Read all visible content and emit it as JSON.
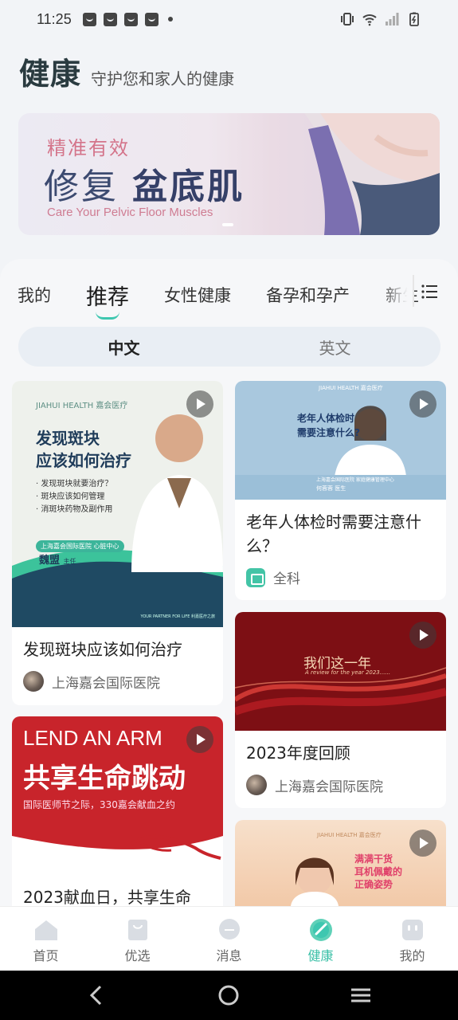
{
  "status_bar": {
    "time": "11:25",
    "notification_icons": [
      "notification-icon",
      "notification-icon",
      "notification-icon",
      "notification-icon"
    ],
    "right_icons": [
      "vibrate-icon",
      "wifi-icon",
      "signal-icon",
      "battery-charging-icon"
    ]
  },
  "header": {
    "title": "健康",
    "subtitle": "守护您和家人的健康"
  },
  "banner": {
    "tag": "精准有效",
    "headline_light": "修复",
    "headline_bold": "盆底肌",
    "subline": "Care Your Pelvic Floor Muscles"
  },
  "tabs": {
    "items": [
      "我的",
      "推荐",
      "女性健康",
      "备孕和孕产",
      "新生"
    ],
    "active": "推荐",
    "menu_icon": "list-menu-icon"
  },
  "language_toggle": {
    "options": [
      "中文",
      "英文"
    ],
    "active": "中文"
  },
  "cards": {
    "left": [
      {
        "title": "发现斑块应该如何治疗",
        "source": "上海嘉会国际医院",
        "image": {
          "brand": "JIAHUI HEALTH 嘉会医疗",
          "heading_line1": "发现斑块",
          "heading_line2": "应该如何治疗",
          "bullets": [
            "· 发现斑块就要治疗？",
            "· 斑块应该如何管理",
            "· 消斑块药物及副作用"
          ],
          "department": "上海嘉会国际医院 心脏中心",
          "doctor": "魏盟",
          "doctor_title": "主任",
          "footer": "YOUR PARTNER FOR LIFE  利嘉医疗之旅"
        }
      },
      {
        "title": "2023献血日，共享生命",
        "image": {
          "english": "LEND AN ARM",
          "heading": "共享生命跳动",
          "caption": "国际医师节之际，330嘉会献血之约"
        }
      }
    ],
    "right": [
      {
        "title": "老年人体检时需要注意什么？",
        "category": "全科",
        "image": {
          "brand": "JIAHUI HEALTH 嘉会医疗",
          "heading_line1": "老年人体检时",
          "heading_line2": "需要注意什么?",
          "department": "上海嘉会国际医院 家庭健康管理中心",
          "doctor": "何蓉蓉 医生"
        }
      },
      {
        "title": "2023年度回顾",
        "source": "上海嘉会国际医院",
        "image": {
          "heading": "我们这一年",
          "subheading": "A review for the year 2023......"
        }
      },
      {
        "image": {
          "brand": "JIAHUI HEALTH 嘉会医疗",
          "heading_line1": "满满干货",
          "heading_line2": "耳机佩戴的",
          "heading_line3": "正确姿势"
        }
      }
    ]
  },
  "bottom_nav": {
    "items": [
      "首页",
      "优选",
      "消息",
      "健康",
      "我的"
    ],
    "active": "健康"
  },
  "colors": {
    "accent": "#39bfa6",
    "title_dark": "#2a3b40",
    "banner_pink": "#d4748a",
    "banner_navy": "#3c4a70"
  }
}
